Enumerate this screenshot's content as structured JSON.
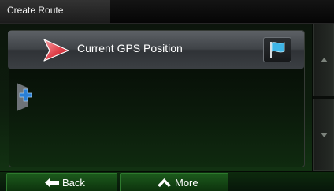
{
  "header": {
    "title": "Create Route"
  },
  "route_list": {
    "items": [
      {
        "label": "Current GPS Position",
        "icon": "start-point-icon",
        "action_icon": "flag-icon"
      }
    ],
    "add_icon": "plus-icon"
  },
  "scroll": {
    "up_icon": "chevron-up-icon",
    "down_icon": "chevron-down-icon"
  },
  "footer": {
    "back_label": "Back",
    "back_icon": "arrow-left-icon",
    "more_label": "More",
    "more_icon": "chevron-up-icon"
  },
  "colors": {
    "start_icon": "#e0404a",
    "flag": "#3fb5e6",
    "plus": "#2a7fd6",
    "bottom_button": "#1c5a1c"
  }
}
